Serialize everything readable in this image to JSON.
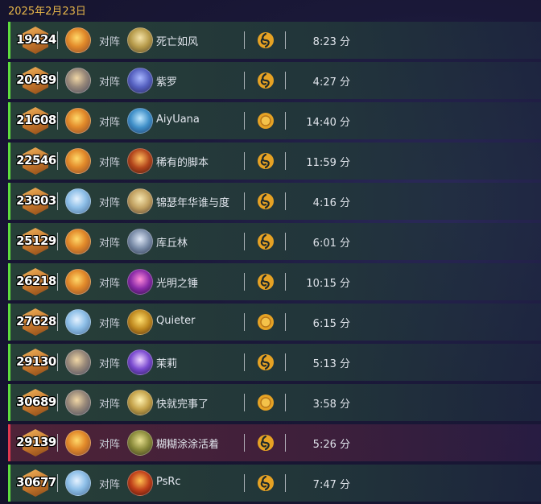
{
  "date": "2025年2月23日",
  "vs_label": "对阵",
  "colors": {
    "win": "#5fdc3f",
    "loss": "#e0384f",
    "accent": "#e7b64a"
  },
  "matches": [
    {
      "rank": "19424",
      "hero": "hero-a",
      "opponent": "死亡如风",
      "opp_avatar": "o1",
      "mode": "swirl",
      "duration": "8:23 分",
      "result": "win"
    },
    {
      "rank": "20489",
      "hero": "hero-c",
      "opponent": "紫罗",
      "opp_avatar": "o2",
      "mode": "swirl",
      "duration": "4:27 分",
      "result": "win"
    },
    {
      "rank": "21608",
      "hero": "hero-a",
      "opponent": "AiyUana",
      "opp_avatar": "o3",
      "mode": "coin",
      "duration": "14:40 分",
      "result": "win"
    },
    {
      "rank": "22546",
      "hero": "hero-a",
      "opponent": "稀有的脚本",
      "opp_avatar": "o4",
      "mode": "swirl",
      "duration": "11:59 分",
      "result": "win"
    },
    {
      "rank": "23803",
      "hero": "hero-b",
      "opponent": "锦瑟年华谁与度",
      "opp_avatar": "o5",
      "mode": "swirl",
      "duration": "4:16 分",
      "result": "win"
    },
    {
      "rank": "25129",
      "hero": "hero-a",
      "opponent": "库丘林",
      "opp_avatar": "o6",
      "mode": "swirl",
      "duration": "6:01 分",
      "result": "win"
    },
    {
      "rank": "26218",
      "hero": "hero-a",
      "opponent": "光明之锤",
      "opp_avatar": "o7",
      "mode": "swirl",
      "duration": "10:15 分",
      "result": "win"
    },
    {
      "rank": "27628",
      "hero": "hero-b",
      "opponent": "Quieter",
      "opp_avatar": "o8",
      "mode": "coin",
      "duration": "6:15 分",
      "result": "win"
    },
    {
      "rank": "29130",
      "hero": "hero-c",
      "opponent": "茉莉",
      "opp_avatar": "o9",
      "mode": "swirl",
      "duration": "5:13 分",
      "result": "win"
    },
    {
      "rank": "30689",
      "hero": "hero-c",
      "opponent": "快就完事了",
      "opp_avatar": "o10",
      "mode": "coin",
      "duration": "3:58 分",
      "result": "win"
    },
    {
      "rank": "29139",
      "hero": "hero-a",
      "opponent": "糊糊涂涂活着",
      "opp_avatar": "o11",
      "mode": "swirl",
      "duration": "5:26 分",
      "result": "loss"
    },
    {
      "rank": "30677",
      "hero": "hero-b",
      "opponent": "PsRc",
      "opp_avatar": "o12",
      "mode": "swirl",
      "duration": "7:47 分",
      "result": "win"
    }
  ]
}
